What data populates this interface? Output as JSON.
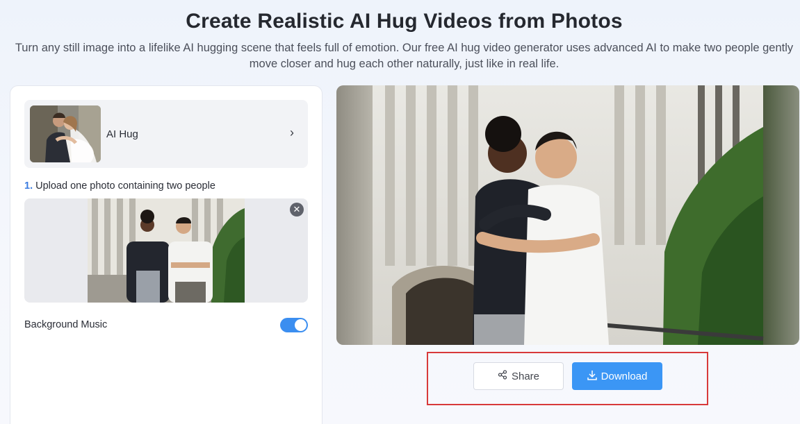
{
  "header": {
    "title": "Create Realistic AI Hug Videos from Photos",
    "subtitle": "Turn any still image into a lifelike AI hugging scene that feels full of emotion. Our free AI hug video generator uses advanced AI to make two people gently move closer and hug each other naturally, just like in real life."
  },
  "model": {
    "label": "AI Hug",
    "chevron": "›"
  },
  "upload": {
    "step_number": "1.",
    "step_text": "Upload one photo containing two people",
    "remove_symbol": "✕"
  },
  "settings": {
    "music_label": "Background Music",
    "music_enabled": true
  },
  "actions": {
    "share_label": "Share",
    "download_label": "Download"
  },
  "colors": {
    "accent": "#3b96f5",
    "highlight_border": "#d83a3a"
  }
}
